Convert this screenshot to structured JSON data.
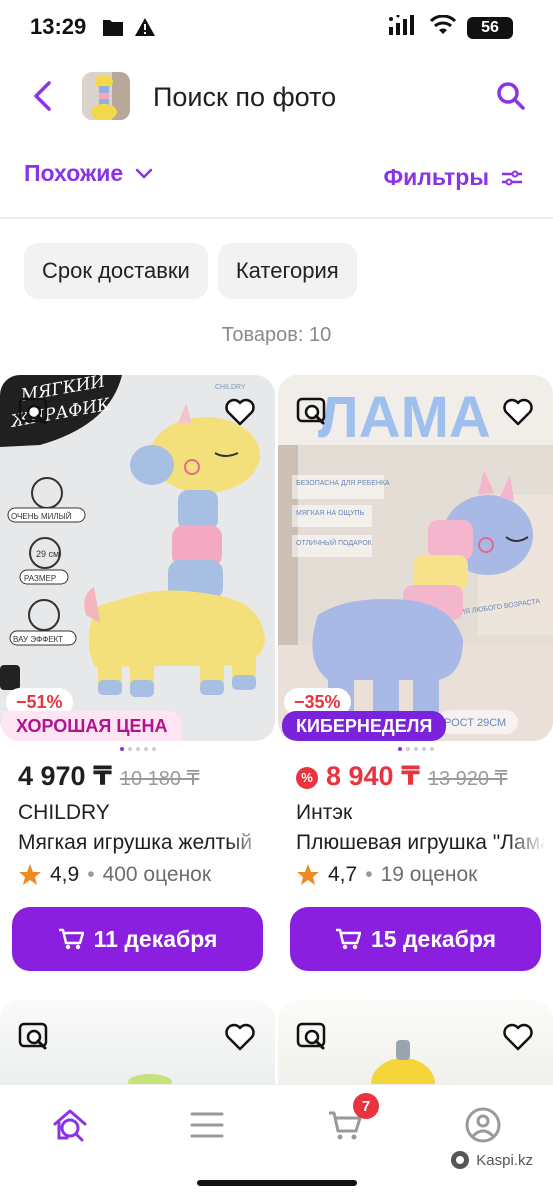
{
  "status_bar": {
    "time": "13:29",
    "battery": "56",
    "icons": [
      "folder-icon",
      "warning-icon",
      "signal-icon",
      "wifi-icon",
      "battery-icon"
    ]
  },
  "header": {
    "title": "Поиск по фото",
    "icons": [
      "back-chevron-icon",
      "search-icon"
    ]
  },
  "sort": {
    "label": "Похожие",
    "icon": "chevron-down-icon"
  },
  "filters": {
    "label": "Фильтры",
    "icon": "sliders-icon"
  },
  "chips": [
    {
      "label": "Срок доставки"
    },
    {
      "label": "Категория"
    }
  ],
  "results_count": "Товаров: 10",
  "products": [
    {
      "discount": "−51%",
      "badge": "ХОРОШАЯ ЦЕНА",
      "price": "4 970 ₸",
      "old_price": "10 180 ₸",
      "brand": "CHILDRY",
      "title": "Мягкая игрушка желтый",
      "rating": "4,9",
      "reviews": "400 оценок",
      "delivery": "11 декабря",
      "image_text": {
        "line1": "МЯГКИЙ",
        "line2": "ЖИРАФИК",
        "tag1": "ОЧЕНЬ МИЛЫЙ",
        "tag2": "29 см",
        "tag3": "РАЗМЕР",
        "tag4": "ВАУ ЭФФЕКТ",
        "brand_mark": "CHILDRY"
      }
    },
    {
      "discount": "−35%",
      "badge": "КИБЕРНЕДЕЛЯ",
      "price": "8 940 ₸",
      "old_price": "13 920 ₸",
      "brand": "Интэк",
      "title": "Плюшевая игрушка \"Лама\"",
      "rating": "4,7",
      "reviews": "19 оценок",
      "delivery": "15 декабря",
      "image_text": {
        "headline": "ЛАМА",
        "b1": "БЕЗОПАСНА ДЛЯ РЕБЕНКА",
        "b2": "МЯГКАЯ НА ОЩУПЬ",
        "b3": "ОТЛИЧНЫЙ ПОДАРОК",
        "side": "ДЛЯ ЛЮБОГО ВОЗРАСТА",
        "size": "РОСТ 29СМ"
      }
    }
  ],
  "bottom_nav": {
    "cart_count": "7",
    "items": [
      "home-search-icon",
      "menu-icon",
      "cart-icon",
      "profile-icon"
    ]
  },
  "watermark": "Kaspi.kz",
  "colors": {
    "accent": "#8b34e6",
    "button": "#8b1fe0",
    "sale": "#e9343f",
    "star": "#f08a24"
  }
}
